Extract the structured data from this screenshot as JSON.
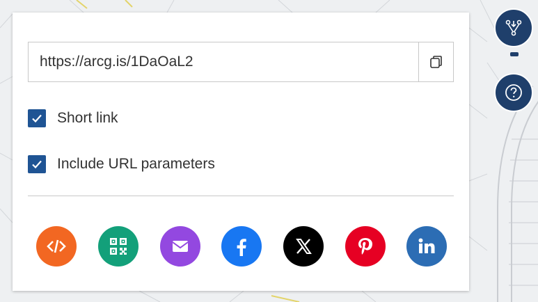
{
  "share": {
    "link_value": "https://arcg.is/1DaOaL2",
    "copy_icon": "copy-icon",
    "options": [
      {
        "label": "Short link",
        "checked": true
      },
      {
        "label": "Include URL parameters",
        "checked": true
      }
    ],
    "social": [
      {
        "name": "embed-code",
        "icon": "code-icon",
        "color": "#f26722"
      },
      {
        "name": "qr-code",
        "icon": "qr-code-icon",
        "color": "#13a07a"
      },
      {
        "name": "email",
        "icon": "envelope-icon",
        "color": "#9348e0"
      },
      {
        "name": "facebook",
        "icon": "facebook-icon",
        "color": "#1877f2"
      },
      {
        "name": "x",
        "icon": "x-logo-icon",
        "color": "#000000"
      },
      {
        "name": "pinterest",
        "icon": "pinterest-icon",
        "color": "#e60023"
      },
      {
        "name": "linkedin",
        "icon": "linkedin-icon",
        "color": "#2c6db4"
      }
    ]
  },
  "side_buttons": [
    {
      "icon": "share-network-icon",
      "active": true
    },
    {
      "icon": "help-icon",
      "active": false
    }
  ],
  "colors": {
    "accent": "#1f5494",
    "side_button": "#1f3f6b"
  }
}
